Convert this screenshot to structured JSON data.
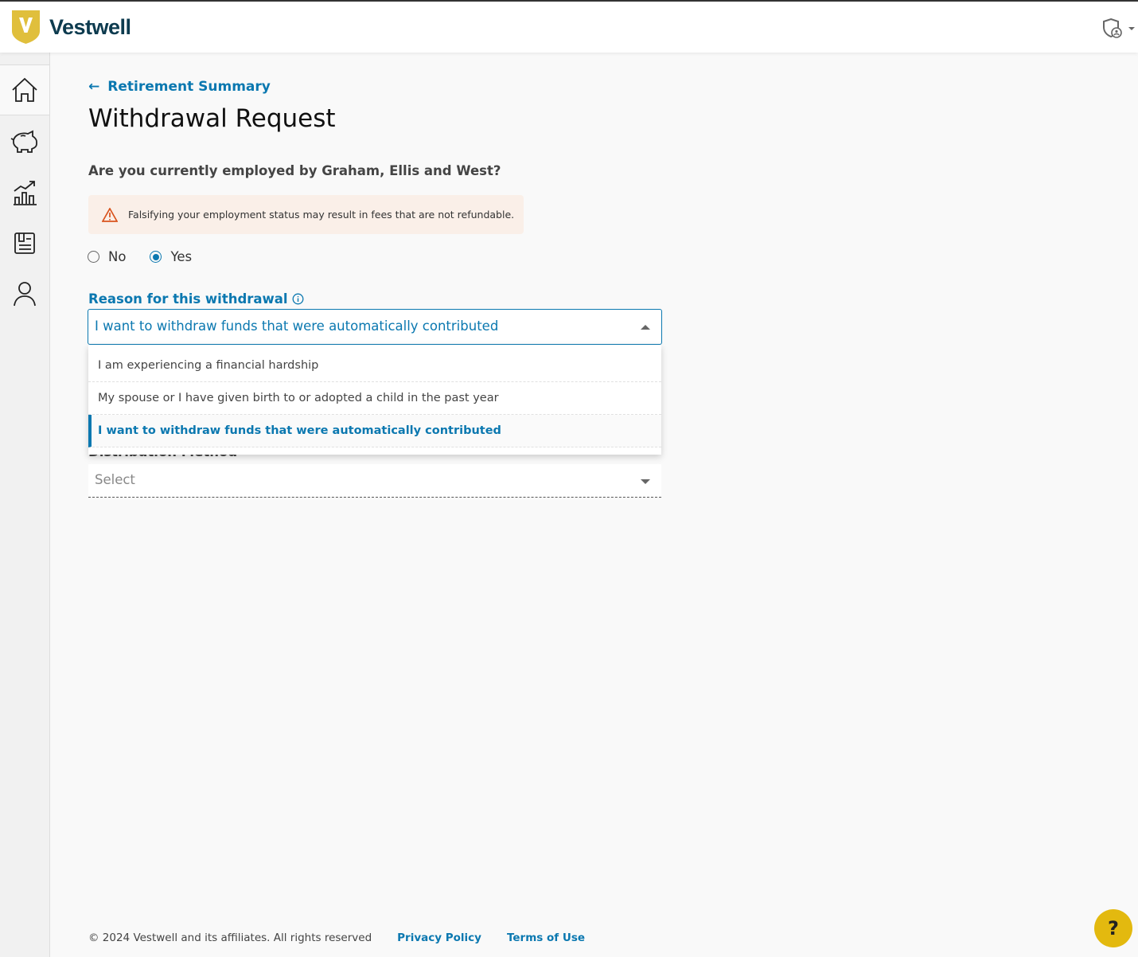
{
  "brand": {
    "name": "Vestwell",
    "logo_letter": "V",
    "accent": "#0b78b0",
    "logo_color": "#e0bf3c"
  },
  "header": {
    "account_icon": "shield-user-icon"
  },
  "sidebar": {
    "items": [
      {
        "name": "home",
        "icon": "home-icon",
        "active": true
      },
      {
        "name": "savings",
        "icon": "piggy-bank-icon"
      },
      {
        "name": "investments",
        "icon": "chart-icon"
      },
      {
        "name": "documents",
        "icon": "document-icon"
      },
      {
        "name": "profile",
        "icon": "user-icon"
      }
    ]
  },
  "main": {
    "back_link": "Retirement Summary",
    "title": "Withdrawal Request",
    "question": "Are you currently employed by Graham, Ellis and West?",
    "alert": "Falsifying your employment status may result in fees that are not refundable.",
    "radios": [
      {
        "label": "No",
        "checked": false
      },
      {
        "label": "Yes",
        "checked": true
      }
    ],
    "reason": {
      "label": "Reason for this withdrawal",
      "value": "I want to withdraw funds that were automatically contributed",
      "options": [
        "I am experiencing a financial hardship",
        "My spouse or I have given birth to or adopted a child in the past year",
        "I want to withdraw funds that were automatically contributed"
      ]
    },
    "distribution": {
      "label": "Distribution Method",
      "placeholder": "Select"
    }
  },
  "footer": {
    "copyright": "© 2024 Vestwell and its affiliates. All rights reserved",
    "privacy": "Privacy Policy",
    "terms": "Terms of Use"
  },
  "help": {
    "label": "?"
  }
}
